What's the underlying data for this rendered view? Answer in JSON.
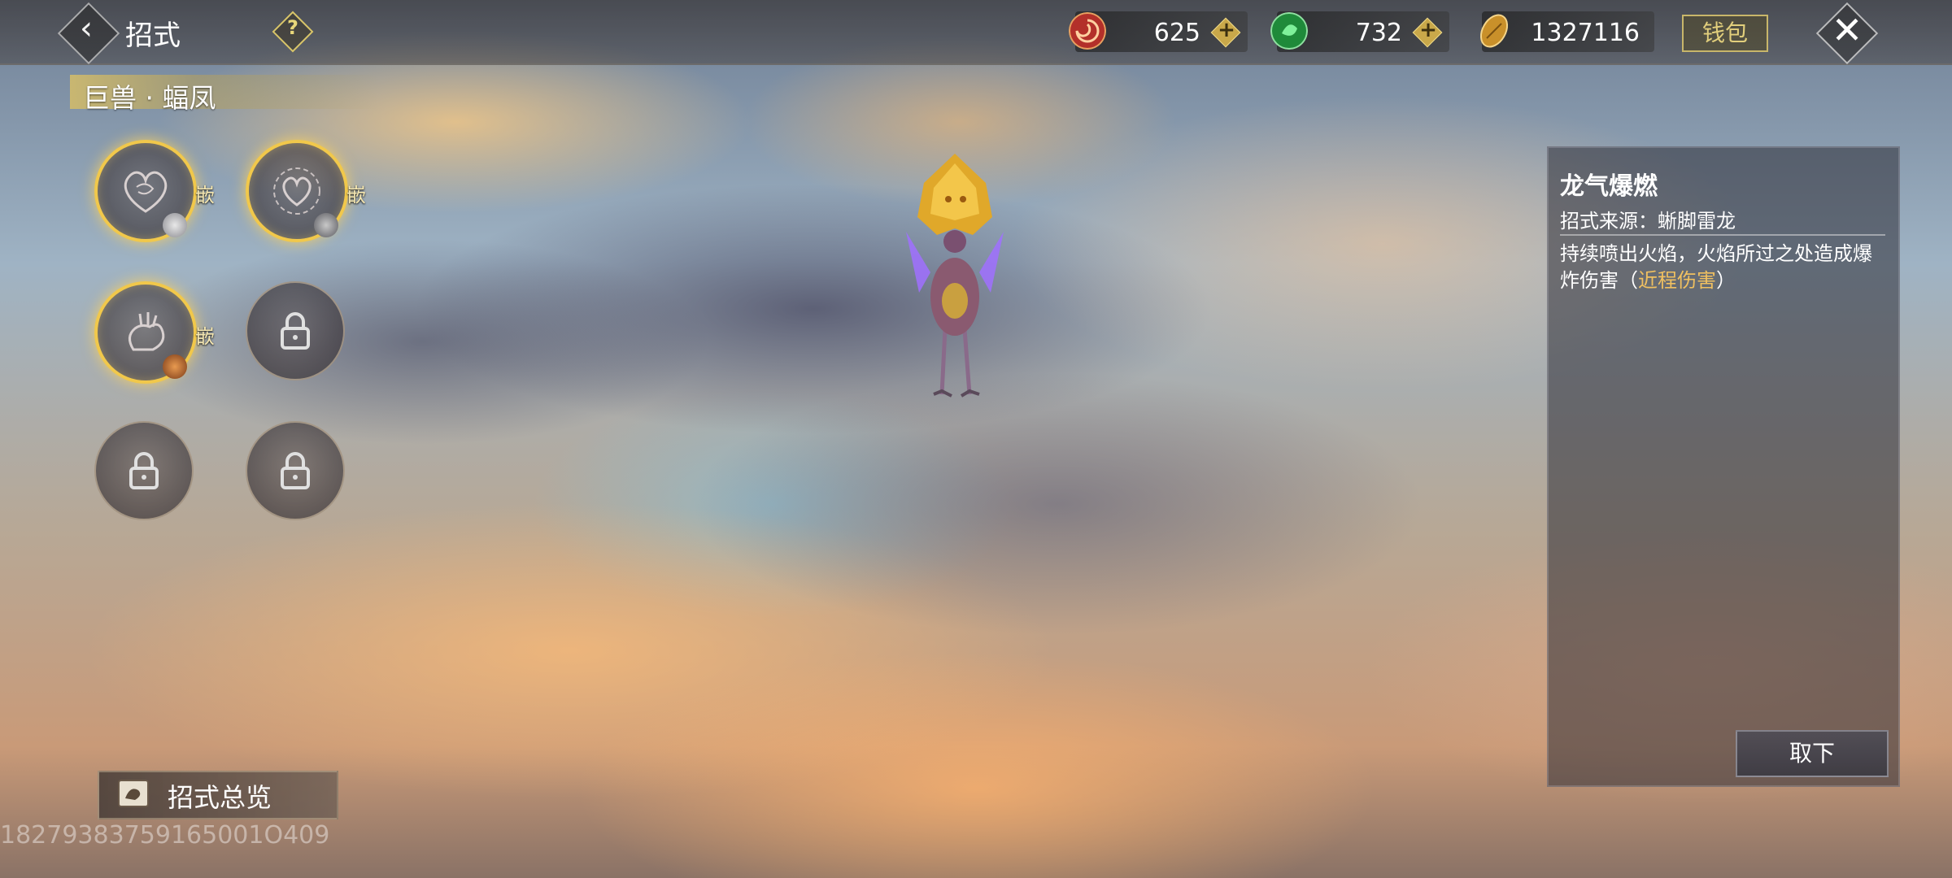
{
  "header": {
    "title": "招式",
    "help_icon": "question-icon",
    "back_icon": "chevron-left-icon",
    "close_icon": "close-x-icon",
    "currencies": [
      {
        "icon": "red-swirl-coin-icon",
        "amount": "625",
        "color": "#c0392b"
      },
      {
        "icon": "green-jade-coin-icon",
        "amount": "732",
        "color": "#2ea84a"
      },
      {
        "icon": "gold-shell-coin-icon",
        "amount": "1327116",
        "color": "#c9902a"
      }
    ],
    "wallet_label": "钱包"
  },
  "beast": {
    "name": "巨兽 · 蝠凤"
  },
  "skill_slots": [
    {
      "state": "filled",
      "emblem": "heart-swirl-emblem-icon",
      "embed_label": "嵌",
      "gem": "silver-gem-icon"
    },
    {
      "state": "filled",
      "emblem": "heart-thorn-emblem-icon",
      "embed_label": "嵌",
      "gem": "grey-gem-icon"
    },
    {
      "state": "filled",
      "emblem": "claw-emblem-icon",
      "embed_label": "嵌",
      "gem": "amber-gem-icon"
    },
    {
      "state": "locked",
      "emblem": "lock-icon"
    },
    {
      "state": "locked",
      "emblem": "lock-icon"
    },
    {
      "state": "locked",
      "emblem": "lock-icon"
    }
  ],
  "overview": {
    "label": "招式总览",
    "icon": "scroll-icon"
  },
  "watermark": "18279383759165001O409",
  "skill_detail": {
    "name": "龙气爆燃",
    "source": "招式来源：蜥脚雷龙",
    "description": "持续喷出火焰，火焰所过之处造成爆炸伤害",
    "paren_open": "（",
    "damage_tag": "近程伤害",
    "paren_close": "）",
    "remove_label": "取下"
  },
  "colors": {
    "accent_gold": "#f1c84b",
    "damage_tag": "#f0c060"
  }
}
